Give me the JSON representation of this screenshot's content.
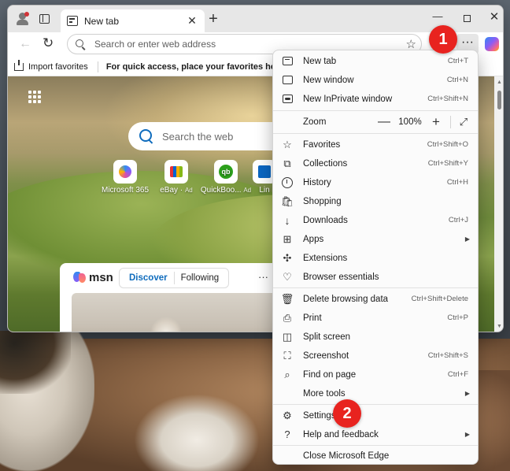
{
  "window": {
    "tab_title": "New tab",
    "new_tab": "+",
    "close_tab": "✕",
    "minimize": "—",
    "close": "✕"
  },
  "toolbar": {
    "address_placeholder": "Search or enter web address",
    "more_label": "···"
  },
  "favorites_bar": {
    "import_label": "Import favorites",
    "hint": "For quick access, place your favorites here on the favori"
  },
  "newtab_page": {
    "search_placeholder": "Search the web",
    "quick_links": [
      {
        "label": "Microsoft 365",
        "ad": ""
      },
      {
        "label": "eBay",
        "ad": "Ad"
      },
      {
        "label": "QuickBoo...",
        "ad": "Ad"
      },
      {
        "label": "Lin",
        "ad": ""
      }
    ],
    "quickbooks_logo": "qb",
    "feed": {
      "brand": "msn",
      "tabs": [
        "Discover",
        "Following"
      ],
      "more": "···"
    }
  },
  "menu": {
    "items": [
      {
        "label": "New tab",
        "shortcut": "Ctrl+T"
      },
      {
        "label": "New window",
        "shortcut": "Ctrl+N"
      },
      {
        "label": "New InPrivate window",
        "shortcut": "Ctrl+Shift+N"
      },
      {
        "label": "Zoom",
        "shortcut": ""
      },
      {
        "label": "Favorites",
        "shortcut": "Ctrl+Shift+O"
      },
      {
        "label": "Collections",
        "shortcut": "Ctrl+Shift+Y"
      },
      {
        "label": "History",
        "shortcut": "Ctrl+H"
      },
      {
        "label": "Shopping",
        "shortcut": ""
      },
      {
        "label": "Downloads",
        "shortcut": "Ctrl+J"
      },
      {
        "label": "Apps",
        "shortcut": ""
      },
      {
        "label": "Extensions",
        "shortcut": ""
      },
      {
        "label": "Browser essentials",
        "shortcut": ""
      },
      {
        "label": "Delete browsing data",
        "shortcut": "Ctrl+Shift+Delete"
      },
      {
        "label": "Print",
        "shortcut": "Ctrl+P"
      },
      {
        "label": "Split screen",
        "shortcut": ""
      },
      {
        "label": "Screenshot",
        "shortcut": "Ctrl+Shift+S"
      },
      {
        "label": "Find on page",
        "shortcut": "Ctrl+F"
      },
      {
        "label": "More tools",
        "shortcut": ""
      },
      {
        "label": "Settings",
        "shortcut": ""
      },
      {
        "label": "Help and feedback",
        "shortcut": ""
      },
      {
        "label": "Close Microsoft Edge",
        "shortcut": ""
      }
    ],
    "zoom": {
      "minus": "—",
      "value": "100%",
      "plus": "+"
    }
  },
  "annotations": {
    "badge_1": "1",
    "badge_2": "2"
  },
  "colors": {
    "accent": "#0f6cbd",
    "badge": "#e8231f"
  }
}
